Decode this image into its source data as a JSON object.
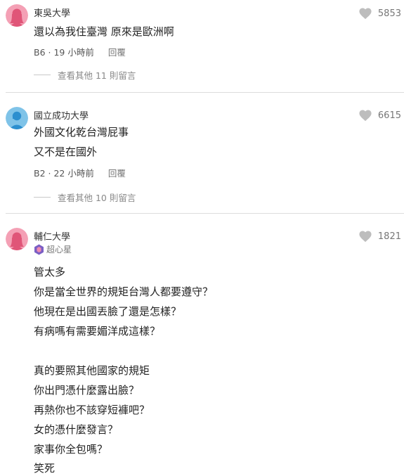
{
  "colors": {
    "avatar_pink": "#f4a0b5",
    "avatar_blue": "#7fc3e8",
    "badge_purple": "#7b5fc4",
    "heart_gray": "#bdbdbd"
  },
  "comments": [
    {
      "school": "東吳大學",
      "likes": "5853",
      "lines": [
        "還以為我住臺灣 原來是歐洲啊"
      ],
      "floor": "B6",
      "time": "19 小時前",
      "reply_label": "回覆",
      "more_replies": "查看其他 11 則留言"
    },
    {
      "school": "國立成功大學",
      "likes": "6615",
      "lines": [
        "外國文化乾台灣屁事",
        "又不是在國外"
      ],
      "floor": "B2",
      "time": "22 小時前",
      "reply_label": "回覆",
      "more_replies": "查看其他 10 則留言"
    },
    {
      "school": "輔仁大學",
      "badge": "超心星",
      "likes": "1821",
      "lines": [
        "管太多",
        "你是當全世界的規矩台灣人都要遵守？",
        "他現在是出國丟臉了還是怎樣？",
        "有病嗎有需要媚洋成這樣？",
        "真的要照其他國家的規矩",
        "你出門憑什麼露出臉？",
        "再熱你也不該穿短褲吧？",
        "女的憑什麼發言？",
        "家事你全包嗎？",
        "笑死"
      ]
    }
  ]
}
